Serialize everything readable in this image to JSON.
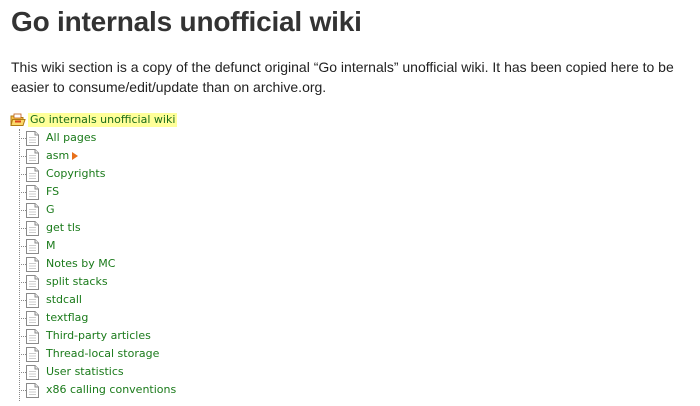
{
  "page": {
    "title": "Go internals unofficial wiki",
    "intro": "This wiki section is a copy of the defunct original “Go internals” unofficial wiki. It has been copied here to be easier to consume/edit/update than on archive.org."
  },
  "tree": {
    "root_label": "Go internals unofficial wiki",
    "root_icon": "open-folder-icon",
    "item_icon": "page-icon",
    "expand_icon": "expand-arrow-icon",
    "colors": {
      "link": "#1a7a1a",
      "highlight": "#ffff99",
      "arrow": "#e8701a"
    },
    "items": [
      {
        "label": "All pages"
      },
      {
        "label": "asm",
        "has_children": true
      },
      {
        "label": "Copyrights"
      },
      {
        "label": "FS"
      },
      {
        "label": "G"
      },
      {
        "label": "get tls"
      },
      {
        "label": "M"
      },
      {
        "label": "Notes by MC"
      },
      {
        "label": "split stacks"
      },
      {
        "label": "stdcall"
      },
      {
        "label": "textflag"
      },
      {
        "label": "Third-party articles"
      },
      {
        "label": "Thread-local storage"
      },
      {
        "label": "User statistics"
      },
      {
        "label": "x86 calling conventions"
      }
    ]
  }
}
